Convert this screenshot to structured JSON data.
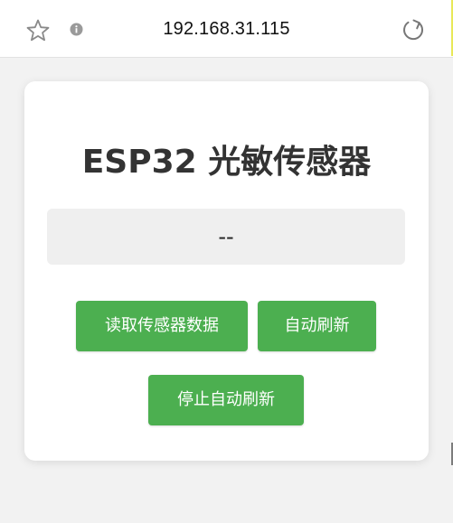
{
  "browser": {
    "url": "192.168.31.115",
    "icons": {
      "bookmark": "star-icon",
      "site_info": "info-icon",
      "reload": "reload-icon"
    }
  },
  "page": {
    "title": "ESP32 光敏传感器",
    "sensor_value": "--",
    "buttons": {
      "read": "读取传感器数据",
      "auto_refresh": "自动刷新",
      "stop_auto_refresh": "停止自动刷新"
    }
  },
  "colors": {
    "accent": "#4caf50",
    "background": "#f2f2f2",
    "card": "#ffffff",
    "value_box": "#efefef",
    "title_text": "#333333"
  }
}
